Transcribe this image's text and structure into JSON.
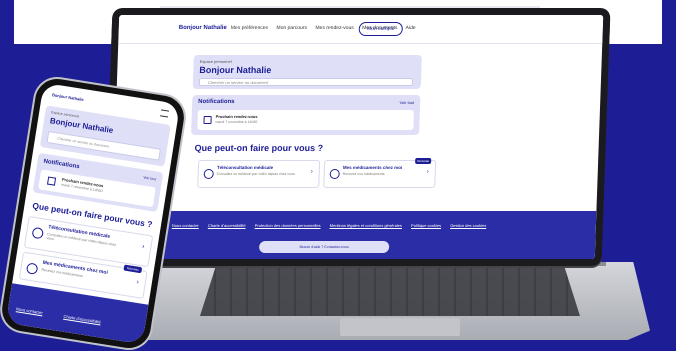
{
  "colors": {
    "brand": "#1d1e96",
    "panel": "#dfe0f7",
    "footer": "#2b2da6"
  },
  "laptop": {
    "brand": "Bonjour Nathalie",
    "nav_items": [
      "Mes préférences",
      "Mon parcours",
      "Mes rendez-vous",
      "Mes documents",
      "Aide"
    ],
    "nav_pill": "Mon compte",
    "hello_small": "Espace personnel",
    "hello": "Bonjour Nathalie",
    "search_placeholder": "Chercher un service ou document",
    "notifications_title": "Notifications",
    "notifications_all": "Voir tout",
    "notif_title": "Prochain rendez-vous",
    "notif_sub": "mardi 7 novembre à 14h30",
    "what_title": "Que peut-on faire pour vous ?",
    "card1_title": "Téléconsultation médicale",
    "card1_sub": "Consultez un médecin par vidéo depuis chez vous",
    "card2_title": "Mes médicaments chez moi",
    "card2_sub": "Recevez vos médicaments",
    "card2_badge": "Nouveau",
    "footer_links": [
      "Nous contacter",
      "Charte d'accessibilité",
      "Protection des données personnelles",
      "Mentions légales et conditions générales",
      "Politique cookies",
      "Gestion des cookies"
    ],
    "footer_bubble": "Besoin d'aide ? Contactez-nous"
  },
  "phone": {
    "top": "Bonjour Nathalie",
    "hello_small": "Espace personnel",
    "hello": "Bonjour Nathalie",
    "search_placeholder": "Chercher un service ou document",
    "notifications_title": "Notifications",
    "notifications_all": "Voir tout",
    "notif_title": "Prochain rendez-vous",
    "notif_sub": "mardi 7 novembre à 14h30",
    "what_title": "Que peut-on faire pour vous ?",
    "card1_title": "Téléconsultation médicale",
    "card1_sub": "Consultez un médecin par vidéo depuis chez vous",
    "card2_title": "Mes médicaments chez moi",
    "card2_sub": "Recevez vos médicaments",
    "card2_badge": "Nouveau",
    "footer_link1": "Nous contacter",
    "footer_link2": "Charte d'accessibilité"
  }
}
